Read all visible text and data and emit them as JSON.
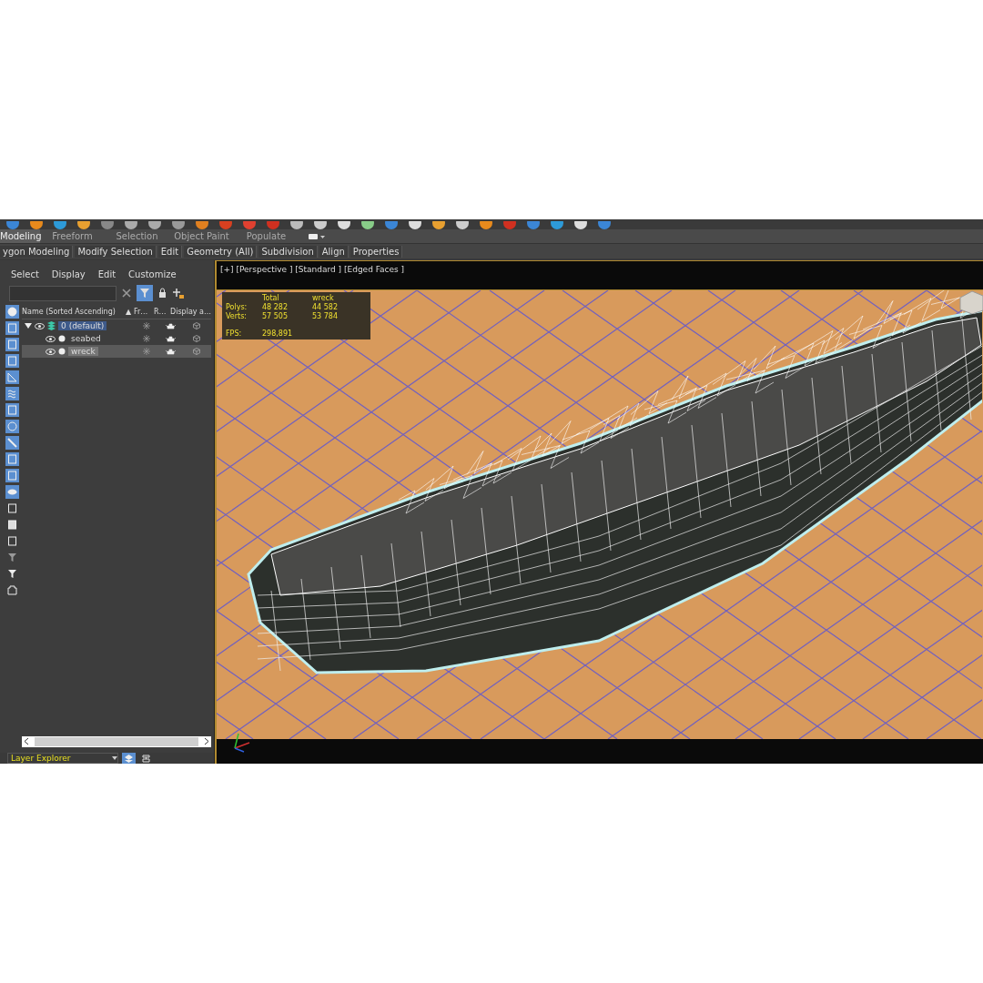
{
  "ribbon": {
    "tabs": [
      {
        "label": "Modeling",
        "selected": true
      },
      {
        "label": "Freeform",
        "selected": false
      },
      {
        "label": "Selection",
        "selected": false
      },
      {
        "label": "Object Paint",
        "selected": false
      },
      {
        "label": "Populate",
        "selected": false
      }
    ],
    "panels": [
      "ygon Modeling",
      "Modify Selection",
      "Edit",
      "Geometry (All)",
      "Subdivision",
      "Align",
      "Properties"
    ]
  },
  "layer_explorer": {
    "menu": [
      "Select",
      "Display",
      "Edit",
      "Customize"
    ],
    "filter_on": true,
    "columns": [
      "Name (Sorted Ascending)",
      "Fr…",
      "R…",
      "Display a…"
    ],
    "sort_indicator": "▲",
    "layers": [
      {
        "name": "0 (default)",
        "current": true,
        "selected": false,
        "expanded": true,
        "children": [
          {
            "name": "seabed",
            "current": false,
            "selected": false
          },
          {
            "name": "wreck",
            "current": false,
            "selected": true
          }
        ]
      }
    ],
    "tools": [
      {
        "on": true
      },
      {
        "on": true
      },
      {
        "on": true
      },
      {
        "on": true
      },
      {
        "on": true
      },
      {
        "on": true
      },
      {
        "on": true
      },
      {
        "on": true
      },
      {
        "on": true
      },
      {
        "on": true
      },
      {
        "on": true
      },
      {
        "on": true
      },
      {
        "on": false
      },
      {
        "on": false
      },
      {
        "on": false
      },
      {
        "on": false
      },
      {
        "on": false
      },
      {
        "on": false
      }
    ],
    "footer": "Layer Explorer"
  },
  "viewport": {
    "label": "[+] [Perspective ] [Standard ] [Edged Faces ]",
    "stats": {
      "headers": [
        "Total",
        "wreck"
      ],
      "rows": [
        {
          "label": "Polys:",
          "values": [
            "48 282",
            "44 582"
          ]
        },
        {
          "label": "Verts:",
          "values": [
            "57 505",
            "53 784"
          ]
        }
      ],
      "fps": {
        "label": "FPS:",
        "value": "298,891"
      }
    }
  }
}
